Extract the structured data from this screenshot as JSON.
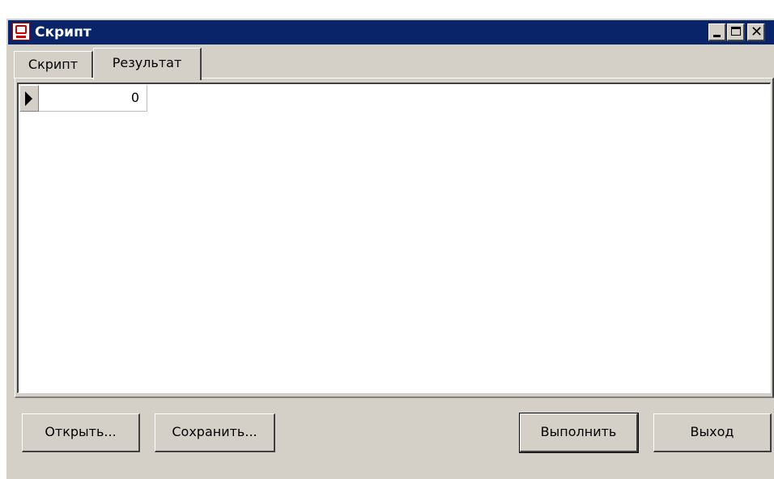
{
  "window": {
    "title": "Скрипт"
  },
  "tabs": [
    {
      "label": "Скрипт",
      "active": false
    },
    {
      "label": "Результат",
      "active": true
    }
  ],
  "grid": {
    "rows": [
      {
        "value": "0"
      }
    ]
  },
  "buttons": {
    "open": "Открыть...",
    "save": "Сохранить...",
    "run": "Выполнить",
    "exit": "Выход"
  },
  "colors": {
    "titlebar": "#0a246a",
    "face": "#d4d0c8",
    "icon": "#d00000"
  }
}
